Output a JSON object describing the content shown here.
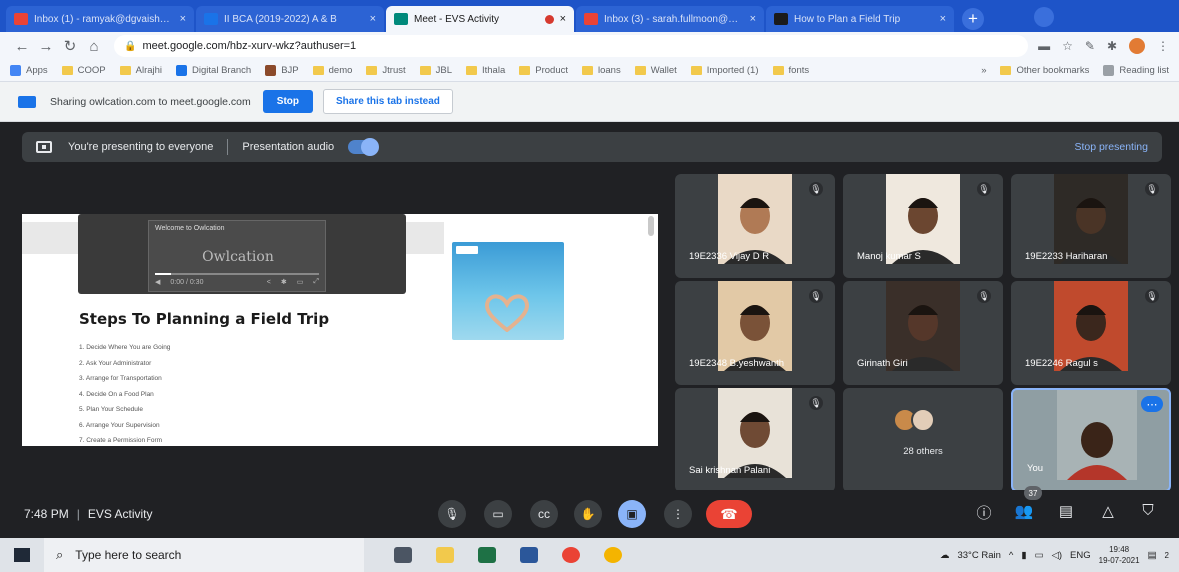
{
  "browser": {
    "tabs": [
      {
        "title": "Inbox (1) - ramyak@dgvaish…",
        "favicon_color": "#ea4335",
        "active": false
      },
      {
        "title": "II BCA (2019-2022) A & B",
        "favicon_color": "#1a73e8",
        "active": false
      },
      {
        "title": "Meet - EVS Activity",
        "favicon_color": "#00897b",
        "active": true
      },
      {
        "title": "Inbox (3) - sarah.fullmoon@…",
        "favicon_color": "#ea4335",
        "active": false
      },
      {
        "title": "How to Plan a Field Trip",
        "favicon_color": "#1b1b1b",
        "active": false
      }
    ],
    "close_glyph": "×",
    "new_tab_glyph": "+",
    "url": "meet.google.com/hbz-xurv-wkz?authuser=1",
    "bookmarks": [
      {
        "label": "Apps",
        "kind": "apps"
      },
      {
        "label": "COOP",
        "kind": "folder"
      },
      {
        "label": "Alrajhi",
        "kind": "folder"
      },
      {
        "label": "Digital Branch",
        "kind": "site"
      },
      {
        "label": "BJP",
        "kind": "site"
      },
      {
        "label": "demo",
        "kind": "folder"
      },
      {
        "label": "Jtrust",
        "kind": "folder"
      },
      {
        "label": "JBL",
        "kind": "folder"
      },
      {
        "label": "Ithala",
        "kind": "folder"
      },
      {
        "label": "Product",
        "kind": "folder"
      },
      {
        "label": "loans",
        "kind": "folder"
      },
      {
        "label": "Wallet",
        "kind": "folder"
      },
      {
        "label": "Imported (1)",
        "kind": "folder"
      },
      {
        "label": "fonts",
        "kind": "folder"
      }
    ],
    "bookmarks_overflow": "»",
    "other_bookmarks": "Other bookmarks",
    "reading_list": "Reading list"
  },
  "infobar": {
    "message": "Sharing owlcation.com to meet.google.com",
    "stop_label": "Stop",
    "share_tab_label": "Share this tab instead"
  },
  "presenting": {
    "status": "You're presenting to everyone",
    "audio_label": "Presentation audio",
    "audio_on": true,
    "stop_label": "Stop presenting"
  },
  "slide": {
    "video_welcome": "Welcome to Owlcation",
    "video_logo": "Owlcation",
    "video_time": "0:00 / 0:30",
    "heading": "Steps To Planning a Field Trip",
    "steps": [
      "1. Decide Where You are Going",
      "2. Ask Your Administrator",
      "3. Arrange for Transportation",
      "4. Decide On a Food Plan",
      "5. Plan Your Schedule",
      "6. Arrange Your Supervision",
      "7. Create a Permission Form"
    ]
  },
  "participants": [
    {
      "name": "19E2336 Vijay D R",
      "skin": "#b07a55",
      "bg": "#e9d9c6"
    },
    {
      "name": "Manoj kumar S",
      "skin": "#6b4630",
      "bg": "#efe8de"
    },
    {
      "name": "19E2233 Hariharan",
      "skin": "#4a3426",
      "bg": "#2e2a26"
    },
    {
      "name": "19E2348 B.yeshwanth",
      "skin": "#7a5238",
      "bg": "#e2c9a6"
    },
    {
      "name": "Girinath Giri",
      "skin": "#55372a",
      "bg": "#3a2f29"
    },
    {
      "name": "19E2246 Ragul s",
      "skin": "#3b271d",
      "bg": "#c04a2d"
    },
    {
      "name": "Sai krishnan Palani",
      "skin": "#6f4a34",
      "bg": "#e8e2d8"
    }
  ],
  "others_label": "28 others",
  "self_label": "You",
  "more_glyph": "⋯",
  "meeting": {
    "time": "7:48 PM",
    "title": "EVS Activity",
    "people_count": "37"
  },
  "taskbar": {
    "search_placeholder": "Type here to search",
    "weather": "33°C Rain",
    "language": "ENG",
    "time": "19:48",
    "date": "19-07-2021",
    "notification_count": "2"
  },
  "colors": {
    "accent": "#1a73e8",
    "meet_bg": "#202124",
    "tile_bg": "#3c4043",
    "hangup": "#ea4335"
  }
}
